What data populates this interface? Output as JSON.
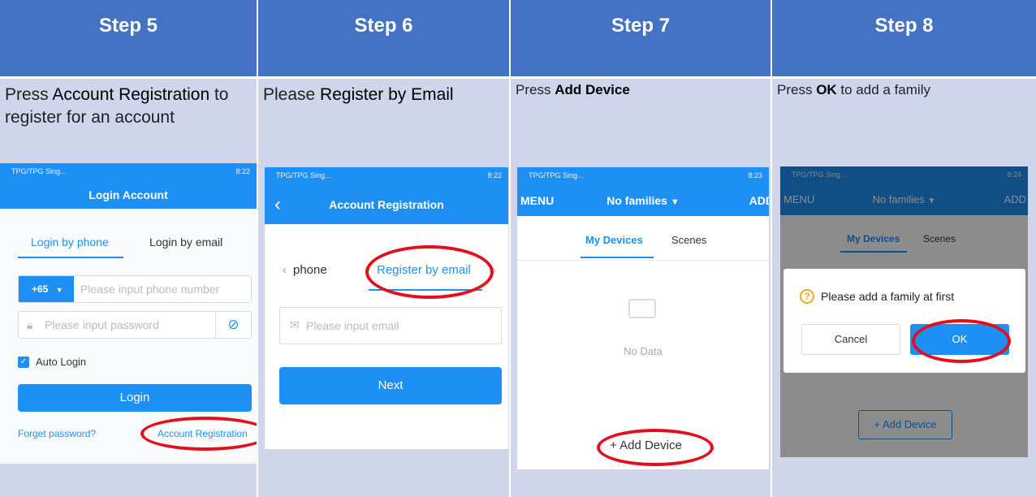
{
  "steps": [
    {
      "title": "Step 5",
      "desc_pre": "Press ",
      "desc_bold": "Account Registration",
      "desc_post": " to register for an account"
    },
    {
      "title": "Step 6",
      "desc_pre": "Please ",
      "desc_bold": "Register by Email",
      "desc_post": ""
    },
    {
      "title": "Step 7",
      "desc_pre": "Press ",
      "desc_bold": "Add Device",
      "desc_post": ""
    },
    {
      "title": "Step 8",
      "desc_pre": "Press ",
      "desc_bold": "OK",
      "desc_post": " to add a family"
    }
  ],
  "status_bar": {
    "carrier": "TPG/TPG Sing...",
    "time5": "8:22",
    "time6": "8:22",
    "time7": "8:23",
    "time8": "8:24"
  },
  "login": {
    "title": "Login Account",
    "tab_phone": "Login by phone",
    "tab_email": "Login by email",
    "country_code": "+65",
    "phone_placeholder": "Please input phone number",
    "password_placeholder": "Please input password",
    "auto_login": "Auto Login",
    "login_button": "Login",
    "forget_password": "Forget password?",
    "account_registration": "Account Registration"
  },
  "register": {
    "title": "Account Registration",
    "tab_phone": "phone",
    "tab_email": "Register by email",
    "email_placeholder": "Please input email",
    "next_button": "Next"
  },
  "home": {
    "menu": "MENU",
    "families": "No families",
    "add": "ADD",
    "tab_devices": "My Devices",
    "tab_scenes": "Scenes",
    "no_data": "No Data",
    "add_device": "Add Device"
  },
  "dialog": {
    "message": "Please add a family at first",
    "cancel": "Cancel",
    "ok": "OK"
  },
  "colors": {
    "header": "#4472c4",
    "panel": "#cfd5ea",
    "app_blue": "#1e90f5",
    "highlight": "#e3101c"
  }
}
